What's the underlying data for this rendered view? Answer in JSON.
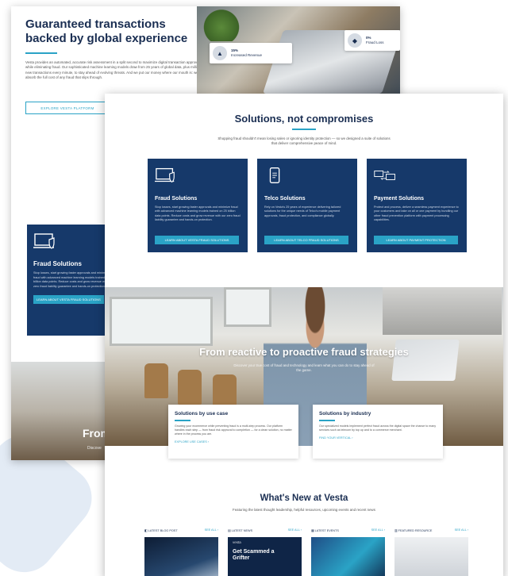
{
  "back_page": {
    "title": "Guaranteed transactions backed by global experience",
    "body": "Vesta provides an automated, accurate risk assessment in a split second to maximize digital transaction approvals while eliminating fraud. Our sophisticated machine learning models draw from 25 years of global data, plus millions of new transactions every minute, to stay ahead of evolving threats. And we put our money where our mouth is: we absorb the full cost of any fraud that slips through.",
    "explore_button": "EXPLORE VESTA PLATFORM",
    "stat_1": {
      "value": "15%",
      "label": "Increased Revenue"
    },
    "stat_2": {
      "value": "0%",
      "label": "Fraud Loss"
    },
    "fraud_panel": {
      "title": "Fraud Solutions",
      "body": "Stop losses, start growing faster approvals and minimize fraud with advanced machine learning models trained on 25 billion data points. Reduce costs and grow revenue with our zero fraud liability guarantee and hands-on protection.",
      "button": "LEARN ABOUT VESTA FRAUD SOLUTIONS"
    },
    "bottom_fragment": "From",
    "bottom_fragment_sub": "Discove"
  },
  "solutions": {
    "title": "Solutions, not compromises",
    "subtitle": "Shopping fraud shouldn't mean losing sales or ignoring identity protection — so we designed a suite of solutions that deliver comprehensive peace of mind.",
    "cards": [
      {
        "title": "Fraud Solutions",
        "body": "Stop losses, start growing faster approvals and minimize fraud with advanced machine learning models trained on 25 billion data points. Reduce costs and grow revenue with our zero fraud liability guarantee and hands-on protection.",
        "button": "LEARN ABOUT VESTA FRAUD SOLUTIONS"
      },
      {
        "title": "Telco Solutions",
        "body": "Rely on Vesta's 25 years of experience delivering tailored solutions for the unique needs of Telco's mobile payment approvals, fraud protection, and compliance globally.",
        "button": "LEARN ABOUT TELCO FRAUD SOLUTIONS"
      },
      {
        "title": "Payment Solutions",
        "body": "Protect and process, deliver a seamless payment experience to your customers and take on all or one payment by bundling our other fraud prevention platform with payment processing capabilities.",
        "button": "LEARN ABOUT PAYMENT PROTECTION"
      }
    ]
  },
  "proactive": {
    "title": "From reactive to proactive fraud strategies",
    "subtitle": "Discover your true cost of fraud and technology and learn what you can do to stay ahead of the game.",
    "use_case": {
      "title": "Solutions by use case",
      "body": "Growing your ecommerce while preventing fraud is a multi-step process. Our platform handles each step — from fraud risk approval to completion — for a clean solution, no matter where in the process you are.",
      "link": "EXPLORE USE CASES ›"
    },
    "industry": {
      "title": "Solutions by industry",
      "body": "Our specialized models implement perfect fraud across the digital space the chance to many services such as telecom by top up and to a commerce merchant.",
      "link": "FIND YOUR VERTICAL ›"
    }
  },
  "news": {
    "title": "What's New at Vesta",
    "subtitle": "Featuring the latest thought leadership, helpful resources, upcoming events and recent news",
    "columns": [
      {
        "label": "LATEST BLOG POST",
        "see_all": "SEE ALL ›"
      },
      {
        "label": "LATEST NEWS",
        "see_all": "SEE ALL ›"
      },
      {
        "label": "LATEST EVENTS",
        "see_all": "SEE ALL ›"
      },
      {
        "label": "FEATURED RESOURCE",
        "see_all": "SEE ALL ›"
      }
    ],
    "news_thumb_text": "Get Scammed a Grifter",
    "news_thumb_brand": "vesta"
  },
  "colors": {
    "navy": "#16396a",
    "accent": "#2aa3c6",
    "heading": "#1a2e52"
  }
}
